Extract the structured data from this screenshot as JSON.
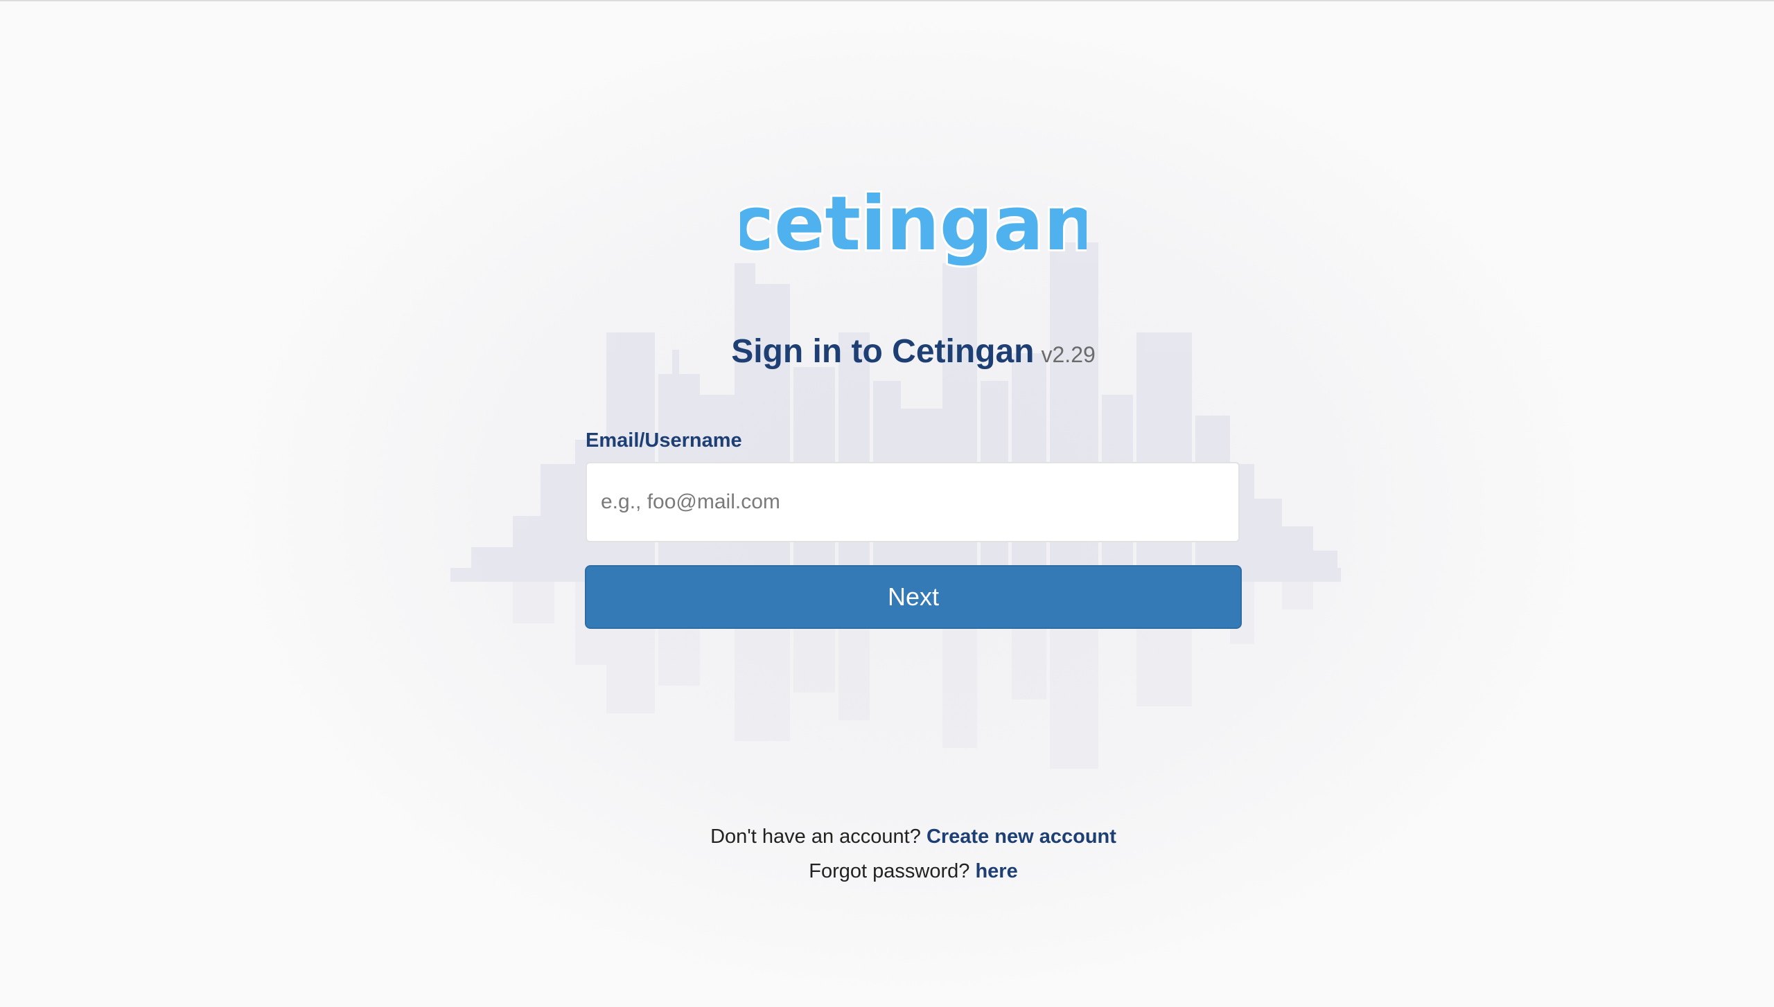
{
  "brand": {
    "logo_text": "cetingan",
    "logo_color": "#4fb2ee"
  },
  "heading": {
    "title": "Sign in to Cetingan",
    "version": "v2.29"
  },
  "form": {
    "email_label": "Email/Username",
    "email_placeholder": "e.g., foo@mail.com",
    "email_value": "",
    "next_label": "Next",
    "next_color": "#337ab7"
  },
  "footer": {
    "no_account_text": "Don't have an account?",
    "create_account_link": "Create new account",
    "forgot_text": "Forgot password?",
    "forgot_link": "here"
  },
  "colors": {
    "heading": "#1d3f73",
    "link": "#1d3f73"
  }
}
